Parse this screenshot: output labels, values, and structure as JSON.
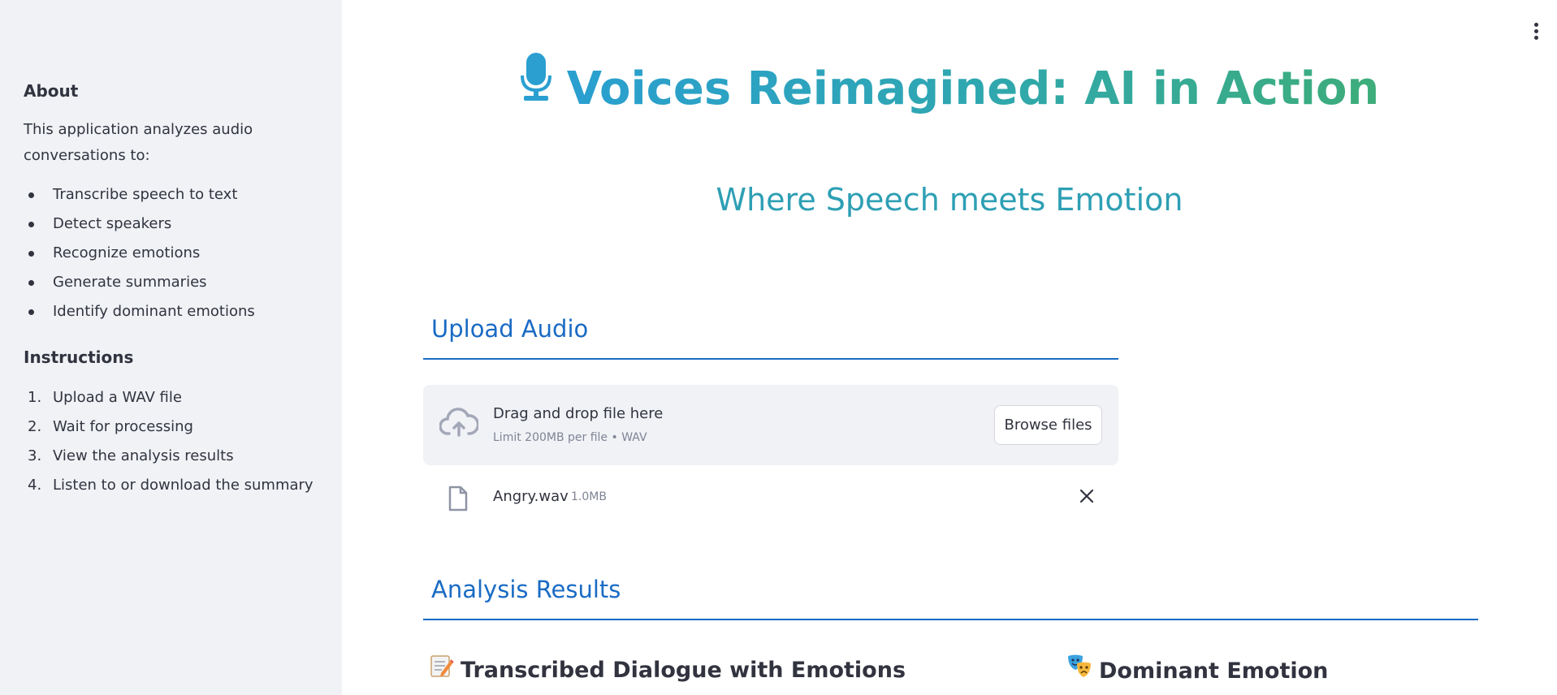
{
  "sidebar": {
    "about_title": "About",
    "about_text": "This application analyzes audio conversations to:",
    "features": [
      "Transcribe speech to text",
      "Detect speakers",
      "Recognize emotions",
      "Generate summaries",
      "Identify dominant emotions"
    ],
    "instructions_title": "Instructions",
    "steps": [
      {
        "num": "1.",
        "text": "Upload a WAV file"
      },
      {
        "num": "2.",
        "text": "Wait for processing"
      },
      {
        "num": "3.",
        "text": "View the analysis results"
      },
      {
        "num": "4.",
        "text": "Listen to or download the summary"
      }
    ]
  },
  "main": {
    "title": "Voices Reimagined: AI in Action",
    "title_icon": "microphone-icon",
    "subtitle": "Where Speech meets Emotion",
    "upload_header": "Upload Audio",
    "uploader": {
      "drag_text": "Drag and drop file here",
      "limit_text": "Limit 200MB per file • WAV",
      "browse_label": "Browse files"
    },
    "uploaded_file": {
      "name": "Angry.wav",
      "size": "1.0MB"
    },
    "results_header": "Analysis Results",
    "transcript_title": "Transcribed Dialogue with Emotions",
    "transcript_icon": "memo-icon",
    "dominant_title": "Dominant Emotion",
    "dominant_icon": "theater-masks-icon"
  },
  "colors": {
    "sidebar_bg": "#f0f2f6",
    "accent_blue": "#1a6bc4",
    "title_gradient_start": "#2a9fd0",
    "title_gradient_end": "#3dad7a",
    "subtitle": "#2e9fb4",
    "text": "#31333f"
  }
}
